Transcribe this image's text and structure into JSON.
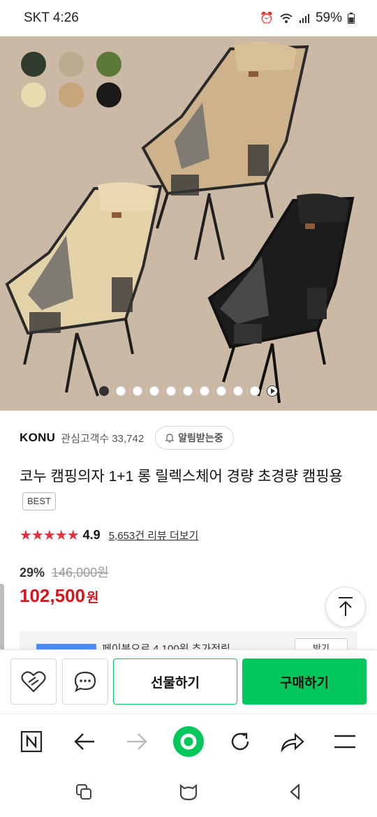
{
  "status_bar": {
    "carrier_time": "SKT 4:26",
    "battery": "59%"
  },
  "hero": {
    "swatch_colors": [
      "#2f3b2e",
      "#b9ab8e",
      "#5b7a38",
      "#eadbb0",
      "#c8a57b",
      "#1a1a1a"
    ],
    "image_count": 11,
    "active_index": 0,
    "play_index": 10
  },
  "seller": {
    "brand": "KONU",
    "followers_label": "관심고객수",
    "followers_count": "33,742",
    "alarm_label": "알림받는중"
  },
  "product": {
    "title": "코누 캠핑의자 1+1 롱 릴렉스체어 경량 초경량 캠핑용",
    "badge": "BEST",
    "stars": "★★★★★",
    "rating": "4.9",
    "review_link": "5,653건 리뷰 더보기",
    "discount": "29%",
    "original_price": "146,000원",
    "sale_price": "102,500",
    "sale_unit": "원"
  },
  "peek": {
    "text": "페이북으로 4,100원 추가적립",
    "button": "받기"
  },
  "actions": {
    "gift": "선물하기",
    "buy": "구매하기"
  },
  "colors": {
    "naver_green": "#03c75a",
    "sale_red": "#d8151c",
    "star_red": "#e0323c"
  },
  "browser_icons": [
    "naver-n-icon",
    "back-arrow-icon",
    "forward-arrow-icon",
    "green-dot-home-icon",
    "reload-icon",
    "share-icon",
    "menu-icon"
  ],
  "system_icons": [
    "recents-icon",
    "home-icon",
    "back-icon"
  ]
}
